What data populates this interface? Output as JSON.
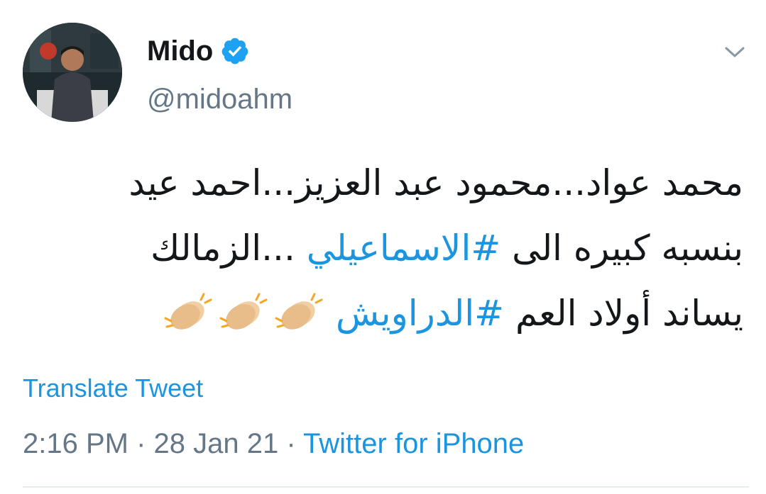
{
  "user": {
    "display_name": "Mido",
    "handle": "@midoahm",
    "verified": true
  },
  "icons": {
    "verified": "verified-badge-icon",
    "caret": "chevron-down-icon",
    "emoji": "clapping-hands-emoji"
  },
  "tweet": {
    "line1": "محمد عواد...محمود عبد العزيز...احمد عيد",
    "line2_before": "بنسبه كبيره الى ",
    "hashtag1": "#الاسماعيلي",
    "line2_after": " ...الزمالك",
    "line3_before": "يساند أولاد العم ",
    "hashtag2": "#الدراويش"
  },
  "translate_label": "Translate Tweet",
  "meta": {
    "time": "2:16 PM",
    "separator1": " · ",
    "date": "28 Jan 21",
    "separator2": " · ",
    "source": "Twitter for iPhone"
  },
  "colors": {
    "link": "#1b95e0",
    "text": "#14171a",
    "secondary": "#657786"
  }
}
